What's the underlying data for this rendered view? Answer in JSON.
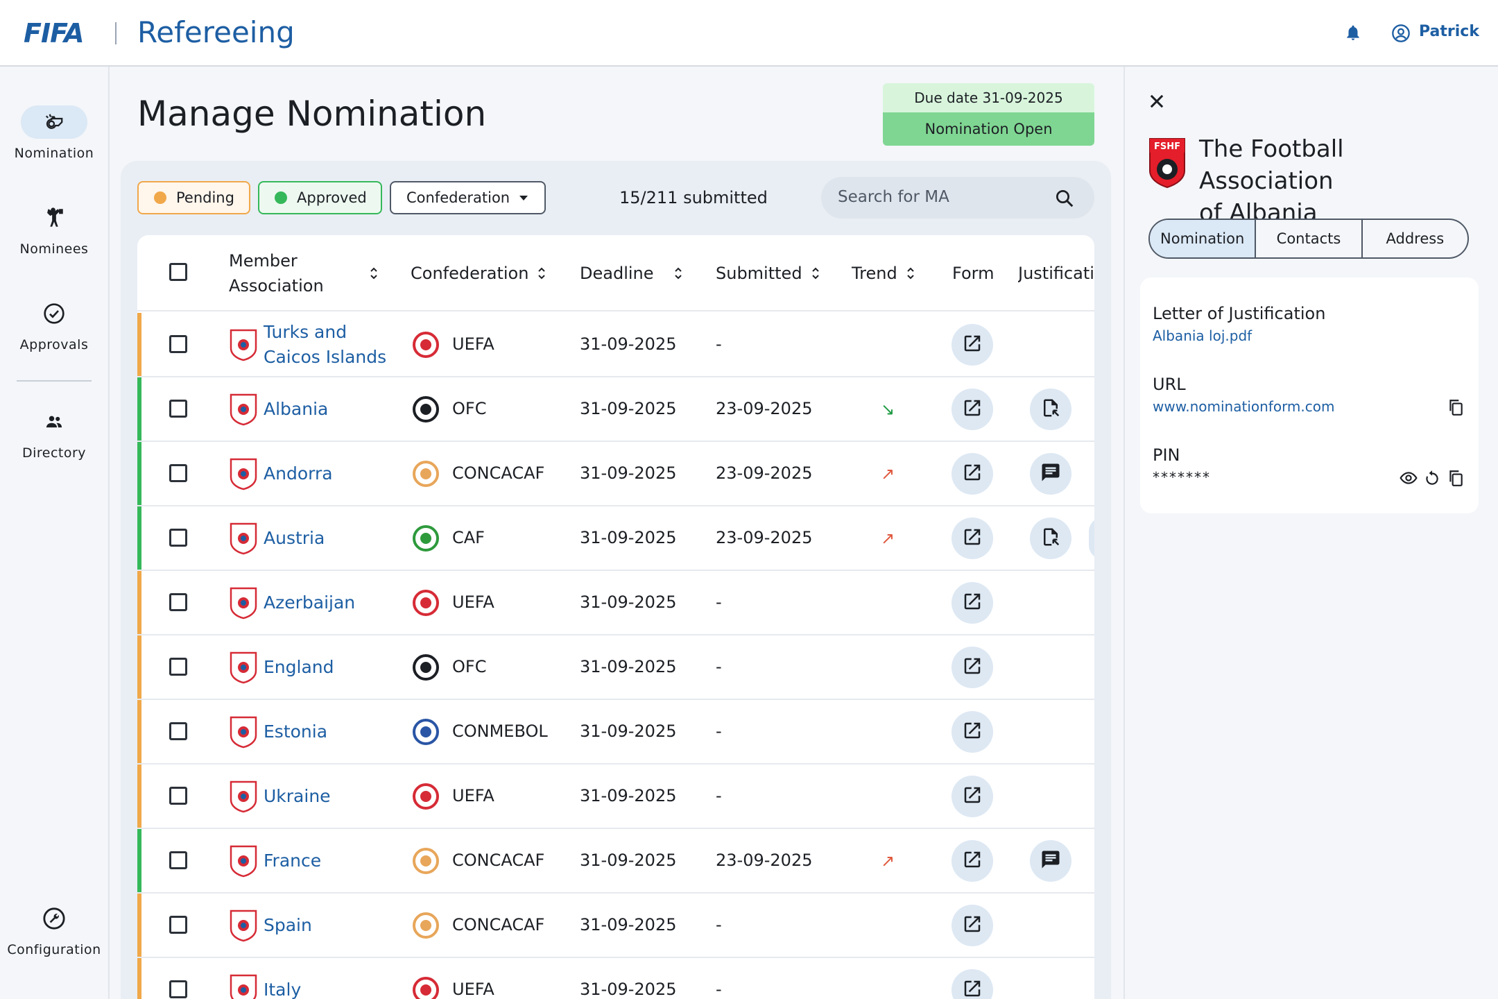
{
  "header": {
    "logo": "FIFA",
    "app_title": "Refereeing",
    "user_name": "Patrick"
  },
  "nav": {
    "items": [
      {
        "label": "Nomination",
        "icon": "whistle-icon",
        "active": true
      },
      {
        "label": "Nominees",
        "icon": "referee-icon",
        "active": false
      },
      {
        "label": "Approvals",
        "icon": "check-circle-icon",
        "active": false
      },
      {
        "label": "Directory",
        "icon": "people-icon",
        "active": false
      }
    ],
    "bottom_item": {
      "label": "Configuration",
      "icon": "settings-wrench-icon"
    }
  },
  "page": {
    "title": "Manage Nomination",
    "due_date": "Due date 31-09-2025",
    "status": "Nomination Open"
  },
  "filters": {
    "pending": "Pending",
    "approved": "Approved",
    "confederation": "Confederation",
    "submitted_count": "15/211 submitted",
    "search_placeholder": "Search for MA"
  },
  "colors": {
    "pending": "#f0a84a",
    "approved": "#35b85a",
    "brand": "#1d5ea3"
  },
  "table": {
    "columns": [
      "Member Association",
      "Confederation",
      "Deadline",
      "Submitted",
      "Trend",
      "Form",
      "Justificati"
    ],
    "rows": [
      {
        "name": "Turks and",
        "name2": "Caicos Islands",
        "status": "pending",
        "conf": "UEFA",
        "conf_icon": "uefa-logo-icon",
        "flag_icon": "turkey-crest-icon",
        "deadline": "31-09-2025",
        "submitted": "-",
        "trend": "",
        "justification": ""
      },
      {
        "name": "Albania",
        "name2": "",
        "status": "approved",
        "conf": "OFC",
        "conf_icon": "ofc-logo-icon",
        "flag_icon": "albania-crest-icon",
        "deadline": "31-09-2025",
        "submitted": "23-09-2025",
        "trend": "↘",
        "trend_dir": "down",
        "justification": "file-icon"
      },
      {
        "name": "Andorra",
        "name2": "",
        "status": "approved",
        "conf": "CONCACAF",
        "conf_icon": "concacaf-logo-icon",
        "flag_icon": "andorra-crest-icon",
        "deadline": "31-09-2025",
        "submitted": "23-09-2025",
        "trend": "↗",
        "trend_dir": "up",
        "justification": "comment-icon"
      },
      {
        "name": "Austria",
        "name2": "",
        "status": "approved",
        "conf": "CAF",
        "conf_icon": "caf-logo-icon",
        "flag_icon": "austria-crest-icon",
        "deadline": "31-09-2025",
        "submitted": "23-09-2025",
        "trend": "↗",
        "trend_dir": "up",
        "justification": "file-icon"
      },
      {
        "name": "Azerbaijan",
        "name2": "",
        "status": "pending",
        "conf": "UEFA",
        "conf_icon": "uefa-logo-icon",
        "flag_icon": "azerbaijan-crest-icon",
        "deadline": "31-09-2025",
        "submitted": "-",
        "trend": "",
        "justification": ""
      },
      {
        "name": "England",
        "name2": "",
        "status": "pending",
        "conf": "OFC",
        "conf_icon": "ofc-logo-icon",
        "flag_icon": "england-crest-icon",
        "deadline": "31-09-2025",
        "submitted": "-",
        "trend": "",
        "justification": ""
      },
      {
        "name": "Estonia",
        "name2": "",
        "status": "pending",
        "conf": "CONMEBOL",
        "conf_icon": "conmebol-logo-icon",
        "flag_icon": "estonia-crest-icon",
        "deadline": "31-09-2025",
        "submitted": "-",
        "trend": "",
        "justification": ""
      },
      {
        "name": "Ukraine",
        "name2": "",
        "status": "pending",
        "conf": "UEFA",
        "conf_icon": "uefa-logo-icon",
        "flag_icon": "ukraine-crest-icon",
        "deadline": "31-09-2025",
        "submitted": "-",
        "trend": "",
        "justification": ""
      },
      {
        "name": "France",
        "name2": "",
        "status": "approved",
        "conf": "CONCACAF",
        "conf_icon": "concacaf-logo-icon",
        "flag_icon": "france-crest-icon",
        "deadline": "31-09-2025",
        "submitted": "23-09-2025",
        "trend": "↗",
        "trend_dir": "up",
        "justification": "comment-icon"
      },
      {
        "name": "Spain",
        "name2": "",
        "status": "pending",
        "conf": "CONCACAF",
        "conf_icon": "concacaf-logo-icon",
        "flag_icon": "spain-crest-icon",
        "deadline": "31-09-2025",
        "submitted": "-",
        "trend": "",
        "justification": ""
      },
      {
        "name": "Italy",
        "name2": "",
        "status": "pending",
        "conf": "UEFA",
        "conf_icon": "uefa-logo-icon",
        "flag_icon": "italy-crest-icon",
        "deadline": "31-09-2025",
        "submitted": "-",
        "trend": "",
        "justification": ""
      }
    ]
  },
  "panel": {
    "title_line1": "The Football Association",
    "title_line2": "of Albania",
    "tabs": [
      "Nomination",
      "Contacts",
      "Address"
    ],
    "letter_label": "Letter of Justification",
    "letter_file": "Albania loj.pdf",
    "url_label": "URL",
    "url_value": "www.nominationform.com",
    "pin_label": "PIN",
    "pin_value": "*******"
  }
}
